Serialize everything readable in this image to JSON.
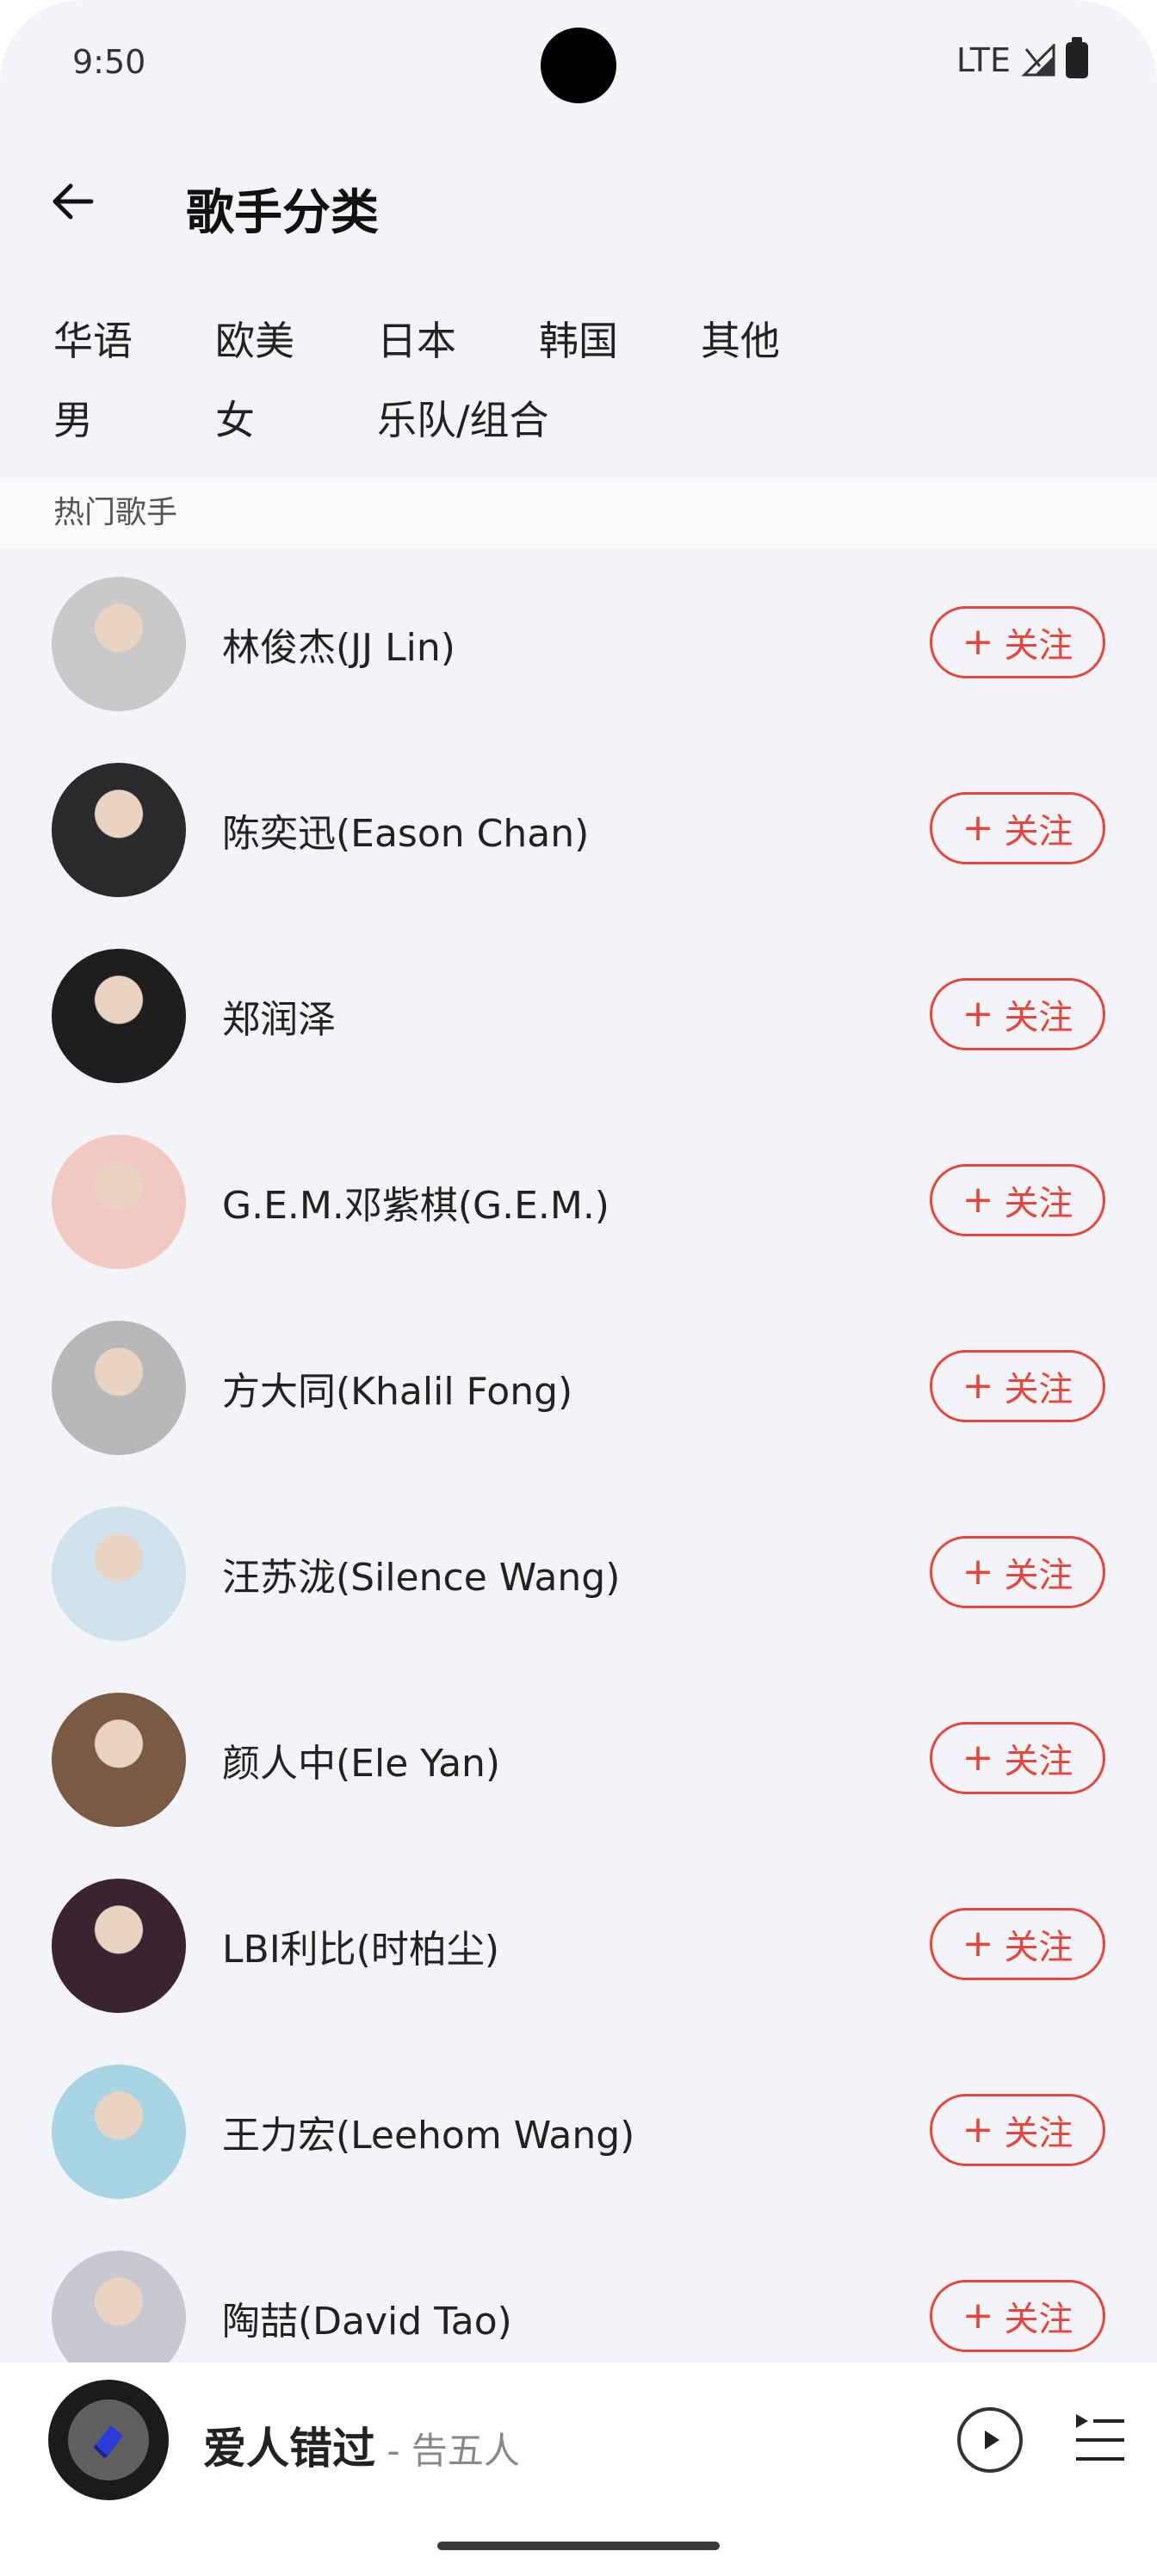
{
  "status_bar": {
    "time": "9:50",
    "network": "LTE"
  },
  "header": {
    "title": "歌手分类"
  },
  "filters": {
    "row1": [
      "华语",
      "欧美",
      "日本",
      "韩国",
      "其他"
    ],
    "row2": [
      "男",
      "女",
      "乐队/组合"
    ]
  },
  "section": {
    "label": "热门歌手"
  },
  "follow_label": "关注",
  "artists": [
    {
      "name": "林俊杰(JJ Lin)",
      "avatar_color": "#c9c9c9"
    },
    {
      "name": "陈奕迅(Eason Chan)",
      "avatar_color": "#2a2a2a"
    },
    {
      "name": "郑润泽",
      "avatar_color": "#1e1e1e"
    },
    {
      "name": "G.E.M.邓紫棋(G.E.M.)",
      "avatar_color": "#f2c9c0"
    },
    {
      "name": "方大同(Khalil Fong)",
      "avatar_color": "#b8b8b8"
    },
    {
      "name": "汪苏泷(Silence Wang)",
      "avatar_color": "#cfe1ec"
    },
    {
      "name": "颜人中(Ele Yan)",
      "avatar_color": "#7a5a45"
    },
    {
      "name": "LBI利比(时柏尘)",
      "avatar_color": "#3a2430"
    },
    {
      "name": "王力宏(Leehom Wang)",
      "avatar_color": "#a9d4e4"
    },
    {
      "name": "陶喆(David Tao)",
      "avatar_color": "#c8c8d2"
    }
  ],
  "player": {
    "song_title": "爱人错过",
    "artist": " - 告五人",
    "play_icon": "play-icon",
    "playlist_icon": "playlist-icon"
  },
  "colors": {
    "accent": "#e8453c",
    "background": "#f3f4f8"
  }
}
